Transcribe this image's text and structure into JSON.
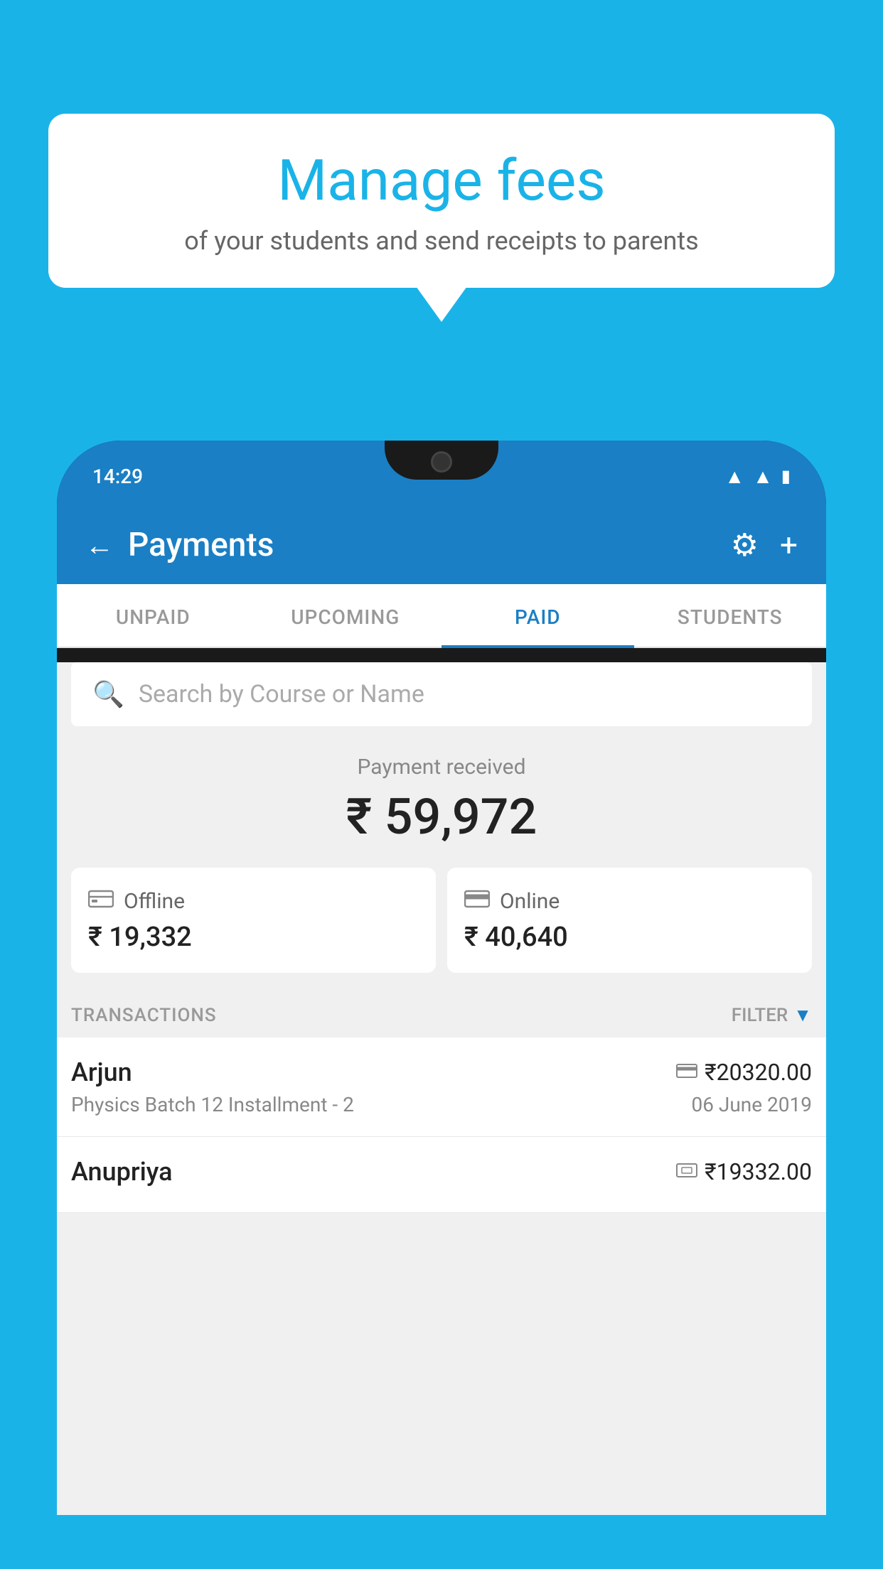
{
  "background_color": "#1ab3e8",
  "bubble": {
    "title": "Manage fees",
    "subtitle": "of your students and send receipts to parents"
  },
  "status_bar": {
    "time": "14:29",
    "icons": [
      "wifi",
      "signal",
      "battery"
    ]
  },
  "header": {
    "title": "Payments",
    "back_label": "←",
    "gear_label": "⚙",
    "plus_label": "+"
  },
  "tabs": [
    {
      "label": "UNPAID",
      "active": false
    },
    {
      "label": "UPCOMING",
      "active": false
    },
    {
      "label": "PAID",
      "active": true
    },
    {
      "label": "STUDENTS",
      "active": false
    }
  ],
  "search": {
    "placeholder": "Search by Course or Name"
  },
  "payment_summary": {
    "label": "Payment received",
    "amount": "₹ 59,972"
  },
  "payment_cards": [
    {
      "type": "Offline",
      "amount": "₹ 19,332",
      "icon": "💳"
    },
    {
      "type": "Online",
      "amount": "₹ 40,640",
      "icon": "💳"
    }
  ],
  "transactions_section": {
    "label": "TRANSACTIONS",
    "filter_label": "FILTER"
  },
  "transactions": [
    {
      "name": "Arjun",
      "course": "Physics Batch 12 Installment - 2",
      "amount": "₹20320.00",
      "date": "06 June 2019",
      "icon_type": "card"
    },
    {
      "name": "Anupriya",
      "course": "",
      "amount": "₹19332.00",
      "date": "",
      "icon_type": "cash"
    }
  ]
}
